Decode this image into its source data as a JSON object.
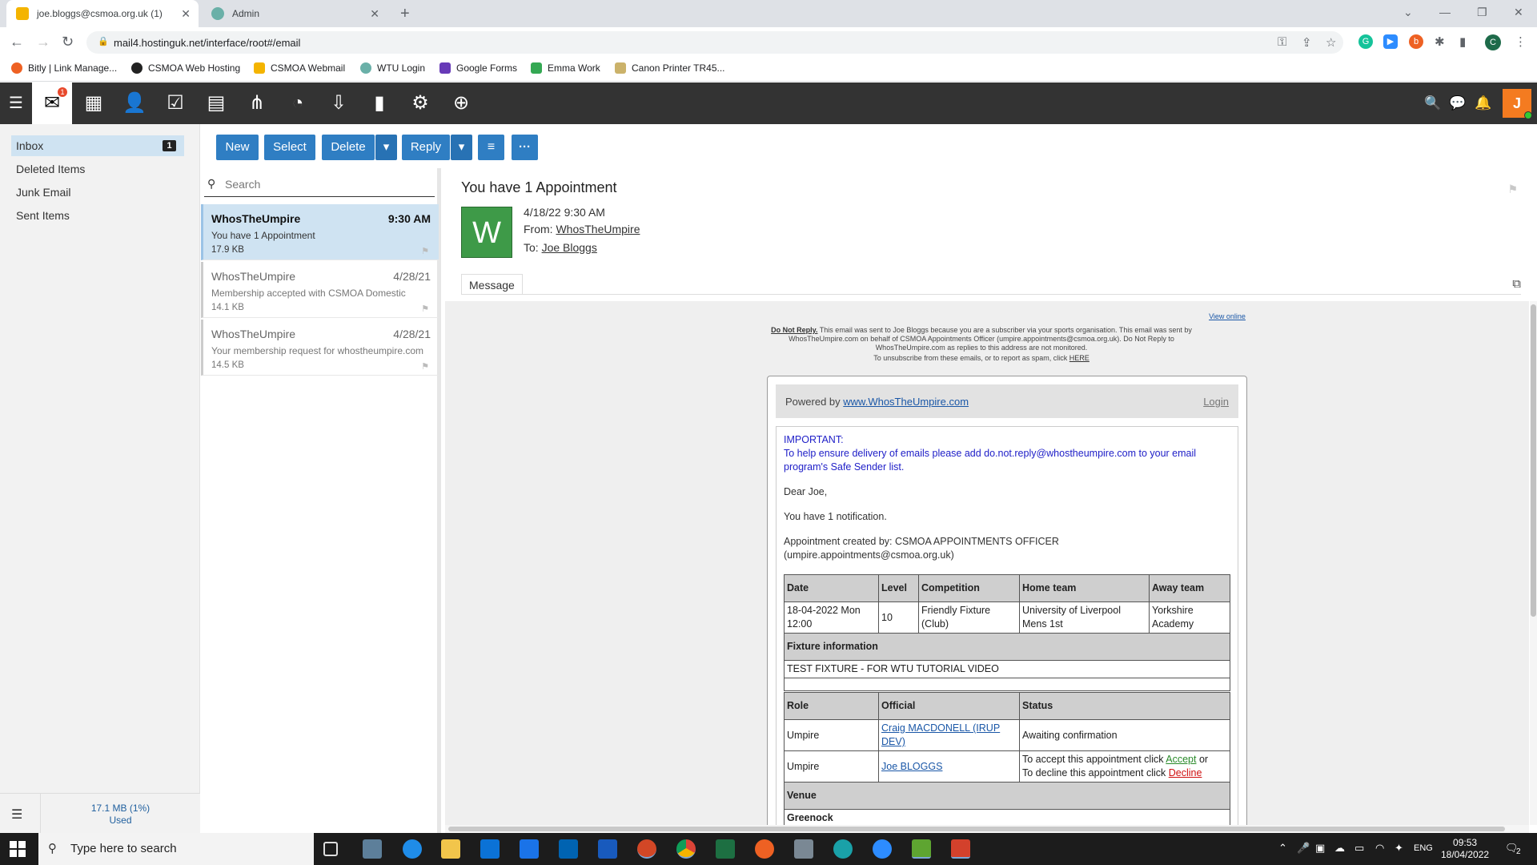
{
  "browser": {
    "tabs": [
      {
        "title": "joe.bloggs@csmoa.org.uk (1)",
        "active": true
      },
      {
        "title": "Admin",
        "active": false
      }
    ],
    "url": "mail4.hostinguk.net/interface/root#/email",
    "bookmarks": [
      "Bitly | Link Manage...",
      "CSMOA Web Hosting",
      "CSMOA Webmail",
      "WTU Login",
      "Google Forms",
      "Emma Work",
      "Canon Printer TR45..."
    ],
    "profile_initial": "C"
  },
  "appbar": {
    "mail_badge": "1",
    "avatar_initial": "J",
    "icons": [
      "menu-icon",
      "mail-icon",
      "calendar-icon",
      "contacts-icon",
      "tasks-icon",
      "notes-icon",
      "sitemap-icon",
      "rss-icon",
      "download-icon",
      "chart-icon",
      "settings-icon",
      "add-icon"
    ]
  },
  "folders": [
    {
      "label": "Inbox",
      "count": "1",
      "selected": true
    },
    {
      "label": "Deleted Items"
    },
    {
      "label": "Junk Email"
    },
    {
      "label": "Sent Items"
    }
  ],
  "quota": {
    "size": "17.1 MB (1%)",
    "label": "Used"
  },
  "actions": {
    "new": "New",
    "select": "Select",
    "delete": "Delete",
    "reply": "Reply",
    "more": "···"
  },
  "search": {
    "placeholder": "Search"
  },
  "messages": [
    {
      "from": "WhosTheUmpire",
      "date": "9:30 AM",
      "subject": "You have 1 Appointment",
      "size": "17.9 KB"
    },
    {
      "from": "WhosTheUmpire",
      "date": "4/28/21",
      "subject": "Membership accepted with CSMOA Domestic",
      "size": "14.1 KB"
    },
    {
      "from": "WhosTheUmpire",
      "date": "4/28/21",
      "subject": "Your membership request for whostheumpire.com",
      "size": "14.5 KB"
    }
  ],
  "reading": {
    "subject": "You have 1 Appointment",
    "avatar": "W",
    "datetime": "4/18/22 9:30 AM",
    "from_label": "From:",
    "from": "WhosTheUmpire",
    "to_label": "To:",
    "to": "Joe Bloggs",
    "tab": "Message"
  },
  "email": {
    "view_online": "View online",
    "do_not_reply": "Do Not Reply.",
    "notice1": " This email was sent to Joe Bloggs because you are a subscriber via your sports organisation. This email was sent by",
    "notice2": "WhosTheUmpire.com on behalf of CSMOA Appointments Officer (umpire.appointments@csmoa.org.uk). Do Not Reply to",
    "notice3": "WhosTheUmpire.com as replies to this address are not monitored.",
    "unsubscribe": "To unsubscribe from these emails, or to report as spam, click ",
    "here": "HERE",
    "powered_by": "Powered by ",
    "powered_link": "www.WhosTheUmpire.com",
    "login": "Login",
    "important": "IMPORTANT:",
    "important_text1": "To help ensure delivery of emails please add do.not.reply@whostheumpire.com to your email",
    "important_text2": "program's Safe Sender list.",
    "greeting": "Dear Joe,",
    "notification": "You have 1 notification.",
    "created_by1": "Appointment created by: CSMOA APPOINTMENTS OFFICER",
    "created_by2": "(umpire.appointments@csmoa.org.uk)",
    "headers": [
      "Date",
      "Level",
      "Competition",
      "Home team",
      "Away team"
    ],
    "row": [
      "18-04-2022 Mon 12:00",
      "10",
      "Friendly Fixture (Club)",
      "University of Liverpool Mens 1st",
      "Yorkshire Academy"
    ],
    "fixture_info": "Fixture information",
    "fixture_text": "TEST FIXTURE - FOR WTU TUTORIAL VIDEO",
    "role_headers": [
      "Role",
      "Official",
      "Status"
    ],
    "roles": [
      {
        "role": "Umpire",
        "official": "Craig MACDONELL (IRUP DEV)",
        "status": "Awaiting confirmation"
      },
      {
        "role": "Umpire",
        "official": "Joe BLOGGS",
        "accept_pre": "To accept this appointment click ",
        "accept": "Accept",
        "accept_post": " or",
        "decline_pre": "To decline this appointment click ",
        "decline": "Decline"
      }
    ],
    "venue": "Venue",
    "venue_name": "Greenock"
  },
  "taskbar": {
    "search_placeholder": "Type here to search",
    "lang": "ENG",
    "time": "09:53",
    "date": "18/04/2022",
    "notif_count": "2"
  }
}
